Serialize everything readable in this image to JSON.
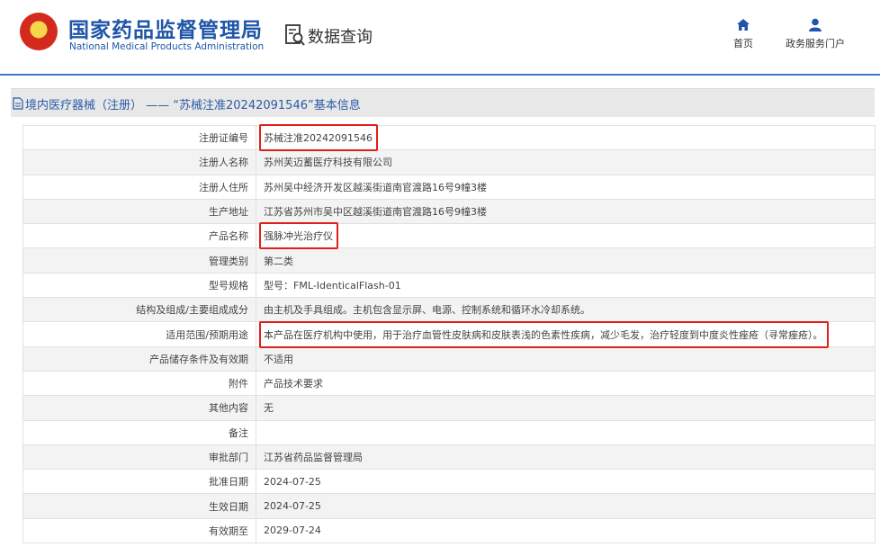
{
  "header": {
    "agency_cn": "国家药品监督管理局",
    "agency_en": "National Medical Products Administration",
    "page_name": "数据查询",
    "nav": [
      {
        "label": "首页",
        "icon": "home-icon"
      },
      {
        "label": "政务服务门户",
        "icon": "user-icon"
      }
    ],
    "accent_color": "#1f56a8"
  },
  "breadcrumb": "境内医疗器械（注册） —— “苏械注准20242091546”基本信息",
  "rows": [
    {
      "label": "注册证编号",
      "value": "苏械注准20242091546",
      "highlighted": true
    },
    {
      "label": "注册人名称",
      "value": "苏州芙迈蓄医疗科技有限公司"
    },
    {
      "label": "注册人住所",
      "value": "苏州吴中经济开发区越溪街道南官渡路16号9幢3楼"
    },
    {
      "label": "生产地址",
      "value": "江苏省苏州市吴中区越溪街道南官渡路16号9幢3楼"
    },
    {
      "label": "产品名称",
      "value": "强脉冲光治疗仪",
      "highlighted": true
    },
    {
      "label": "管理类别",
      "value": "第二类"
    },
    {
      "label": "型号规格",
      "value": "型号：FML-IdenticalFlash-01"
    },
    {
      "label": "结构及组成/主要组成成分",
      "value": "由主机及手具组成。主机包含显示屏、电源、控制系统和循环水冷却系统。"
    },
    {
      "label": "适用范围/预期用途",
      "value": "本产品在医疗机构中使用，用于治疗血管性皮肤病和皮肤表浅的色素性疾病，减少毛发，治疗轻度到中度炎性痤疮（寻常痤疮）。",
      "highlighted": true
    },
    {
      "label": "产品储存条件及有效期",
      "value": "不适用"
    },
    {
      "label": "附件",
      "value": "产品技术要求"
    },
    {
      "label": "其他内容",
      "value": "无"
    },
    {
      "label": "备注",
      "value": ""
    },
    {
      "label": "审批部门",
      "value": "江苏省药品监督管理局"
    },
    {
      "label": "批准日期",
      "value": "2024-07-25"
    },
    {
      "label": "生效日期",
      "value": "2024-07-25"
    },
    {
      "label": "有效期至",
      "value": "2029-07-24"
    }
  ]
}
